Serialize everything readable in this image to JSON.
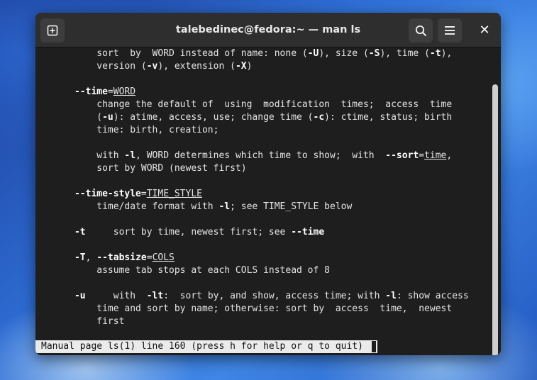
{
  "window": {
    "title": "talebedinec@fedora:~ — man ls"
  },
  "toolbar": {
    "new_tab_icon": "new-tab-icon",
    "search_icon": "search-icon",
    "menu_icon": "hamburger-menu-icon",
    "close_label": "✕"
  },
  "terminal": {
    "lines": [
      {
        "text": "          sort  by  WORD instead of name: none (-U), size (-S), time (-t),"
      },
      {
        "text": "          version (-v), extension (-X)"
      },
      {
        "text": ""
      },
      {
        "text": "      --time=WORD"
      },
      {
        "text": "          change the default of  using  modification  times;  access  time"
      },
      {
        "text": "          (-u): atime, access, use; change time (-c): ctime, status; birth"
      },
      {
        "text": "          time: birth, creation;"
      },
      {
        "text": ""
      },
      {
        "text": "          with -l, WORD determines which time to show;  with  --sort=time,"
      },
      {
        "text": "          sort by WORD (newest first)"
      },
      {
        "text": ""
      },
      {
        "text": "      --time-style=TIME_STYLE"
      },
      {
        "text": "          time/date format with -l; see TIME_STYLE below"
      },
      {
        "text": ""
      },
      {
        "text": "      -t     sort by time, newest first; see --time"
      },
      {
        "text": ""
      },
      {
        "text": "      -T, --tabsize=COLS"
      },
      {
        "text": "          assume tab stops at each COLS instead of 8"
      },
      {
        "text": ""
      },
      {
        "text": "      -u     with  -lt:  sort by, and show, access time; with -l: show access"
      },
      {
        "text": "          time and sort by name; otherwise: sort by  access  time,  newest"
      },
      {
        "text": "          first"
      }
    ],
    "status": "Manual page ls(1) line 160 (press h for help or q to quit)"
  }
}
